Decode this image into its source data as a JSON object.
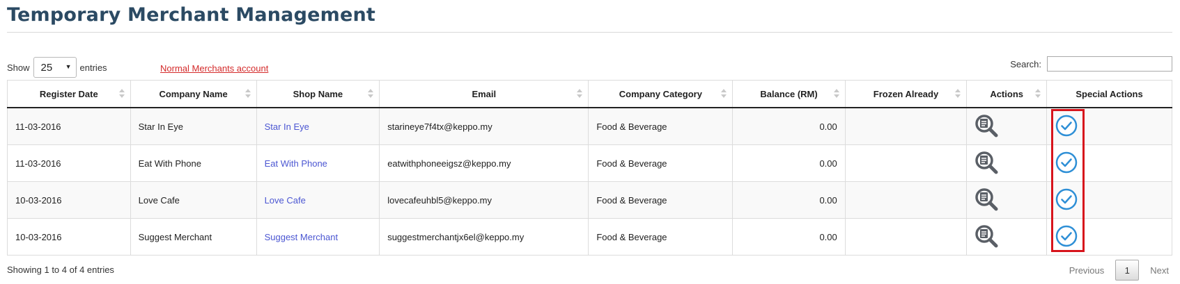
{
  "page": {
    "title": "Temporary Merchant Management"
  },
  "controls": {
    "show_label": "Show",
    "page_length": "25",
    "entries_label": "entries",
    "normal_link": "Normal Merchants account",
    "search_label": "Search:",
    "search_value": ""
  },
  "table": {
    "columns": [
      "Register Date",
      "Company Name",
      "Shop Name",
      "Email",
      "Company Category",
      "Balance (RM)",
      "Frozen Already",
      "Actions",
      "Special Actions"
    ],
    "rows": [
      {
        "date": "11-03-2016",
        "company": "Star In Eye",
        "shop": "Star In Eye",
        "email": "starineye7f4tx@keppo.my",
        "category": "Food & Beverage",
        "balance": "0.00",
        "frozen": ""
      },
      {
        "date": "11-03-2016",
        "company": "Eat With Phone",
        "shop": "Eat With Phone",
        "email": "eatwithphoneeigsz@keppo.my",
        "category": "Food & Beverage",
        "balance": "0.00",
        "frozen": ""
      },
      {
        "date": "10-03-2016",
        "company": "Love Cafe",
        "shop": "Love Cafe",
        "email": "lovecafeuhbl5@keppo.my",
        "category": "Food & Beverage",
        "balance": "0.00",
        "frozen": ""
      },
      {
        "date": "10-03-2016",
        "company": "Suggest Merchant",
        "shop": "Suggest Merchant",
        "email": "suggestmerchantjx6el@keppo.my",
        "category": "Food & Beverage",
        "balance": "0.00",
        "frozen": ""
      }
    ],
    "row_icons": {
      "action": "magnifier-document-icon",
      "special": "check-circle-icon"
    }
  },
  "footer": {
    "info": "Showing 1 to 4 of 4 entries",
    "previous": "Previous",
    "current_page": "1",
    "next": "Next"
  },
  "colors": {
    "title": "#2b4a63",
    "link_red": "#d42a2a",
    "shop_link": "#4b56d2",
    "balance_red": "#d9251d",
    "check_blue": "#2e8fd6",
    "highlight": "#d7141c"
  }
}
